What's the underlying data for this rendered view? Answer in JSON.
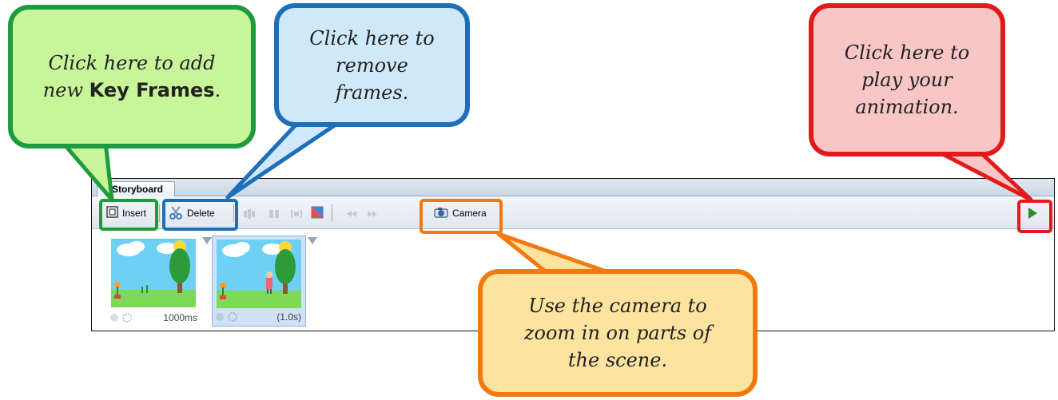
{
  "storyboard": {
    "tab_label": "Storyboard",
    "toolbar": {
      "insert_label": "Insert",
      "delete_label": "Delete",
      "camera_label": "Camera"
    },
    "frames": [
      {
        "duration": "1000ms",
        "selected": false
      },
      {
        "duration": "(1.0s)",
        "selected": true
      }
    ]
  },
  "callouts": {
    "insert": {
      "text_before": "Click here to add new ",
      "text_bold": "Key Frames",
      "text_after": ".",
      "color": "#1e9b3c",
      "fill": "#c9f59a"
    },
    "delete": {
      "text": "Click here to remove frames.",
      "color": "#1f6fb8",
      "fill": "#cfe9fb"
    },
    "play": {
      "text": "Click here to play your animation.",
      "color": "#e11b1b",
      "fill": "#f8c6c6"
    },
    "camera": {
      "text": "Use the camera to zoom in on parts of the scene.",
      "color": "#f07a10",
      "fill": "#fde3a0"
    }
  },
  "icons": [
    "insert-frame-icon",
    "scissors-icon",
    "align-icon",
    "camera-icon",
    "rewind-icon",
    "fast-forward-icon",
    "play-icon",
    "settings-gear-icon"
  ]
}
